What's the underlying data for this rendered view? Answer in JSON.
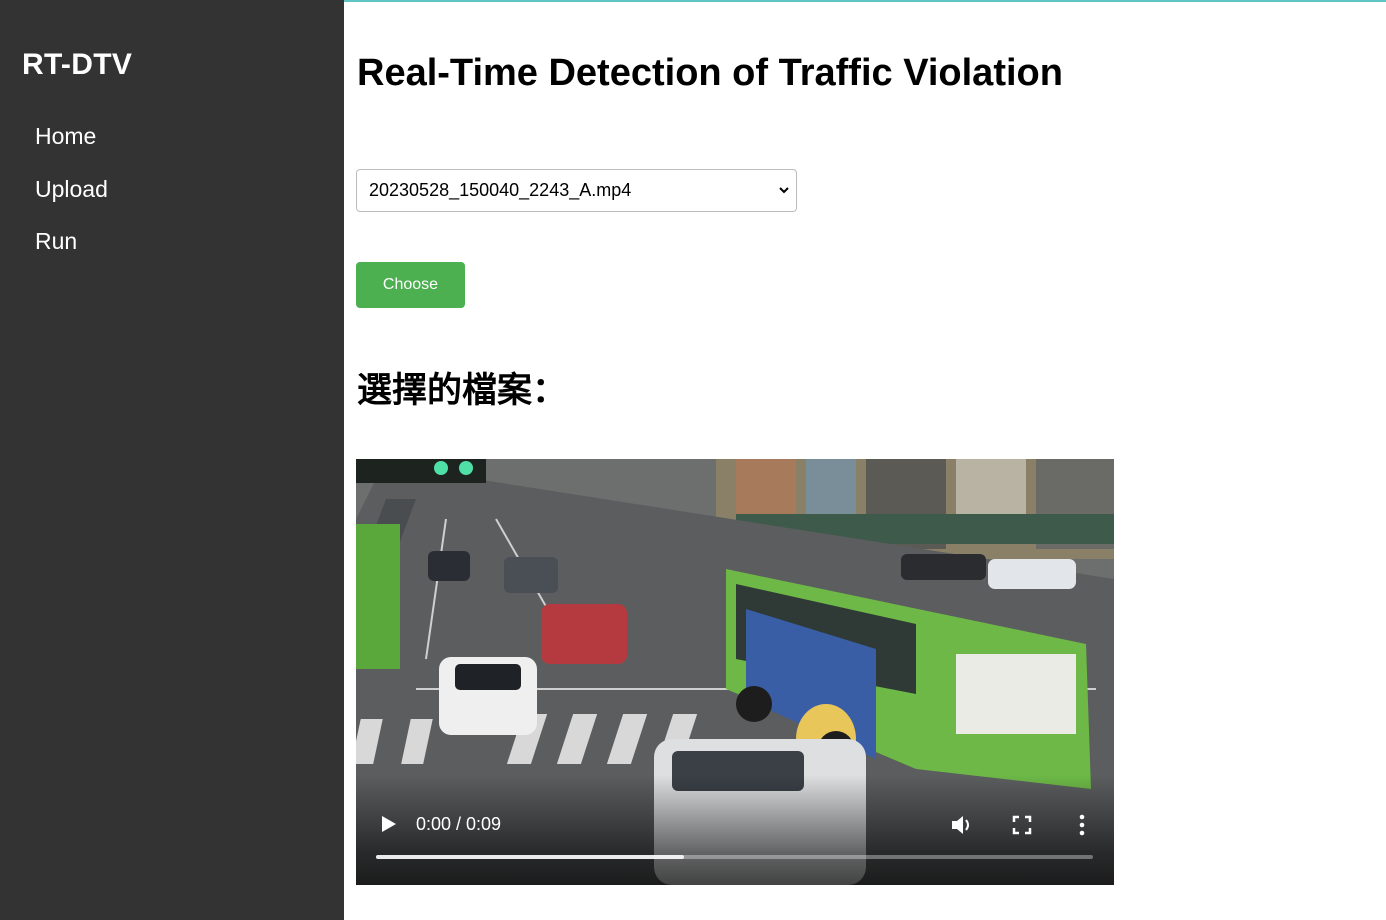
{
  "sidebar": {
    "brand": "RT-DTV",
    "items": [
      {
        "label": "Home"
      },
      {
        "label": "Upload"
      },
      {
        "label": "Run"
      }
    ]
  },
  "main": {
    "title": "Real-Time Detection of Traffic Violation",
    "file_select": {
      "selected": "20230528_150040_2243_A.mp4"
    },
    "choose_button": "Choose",
    "selected_heading": "選擇的檔案：",
    "video": {
      "time": "0:00 / 0:09",
      "buffered_fraction": 0.43,
      "icons": [
        "play-icon",
        "volume-icon",
        "fullscreen-icon",
        "more-options-icon"
      ]
    }
  },
  "colors": {
    "sidebar_bg": "#333333",
    "button_green": "#4caf50",
    "top_accent": "#5fc4c4"
  }
}
